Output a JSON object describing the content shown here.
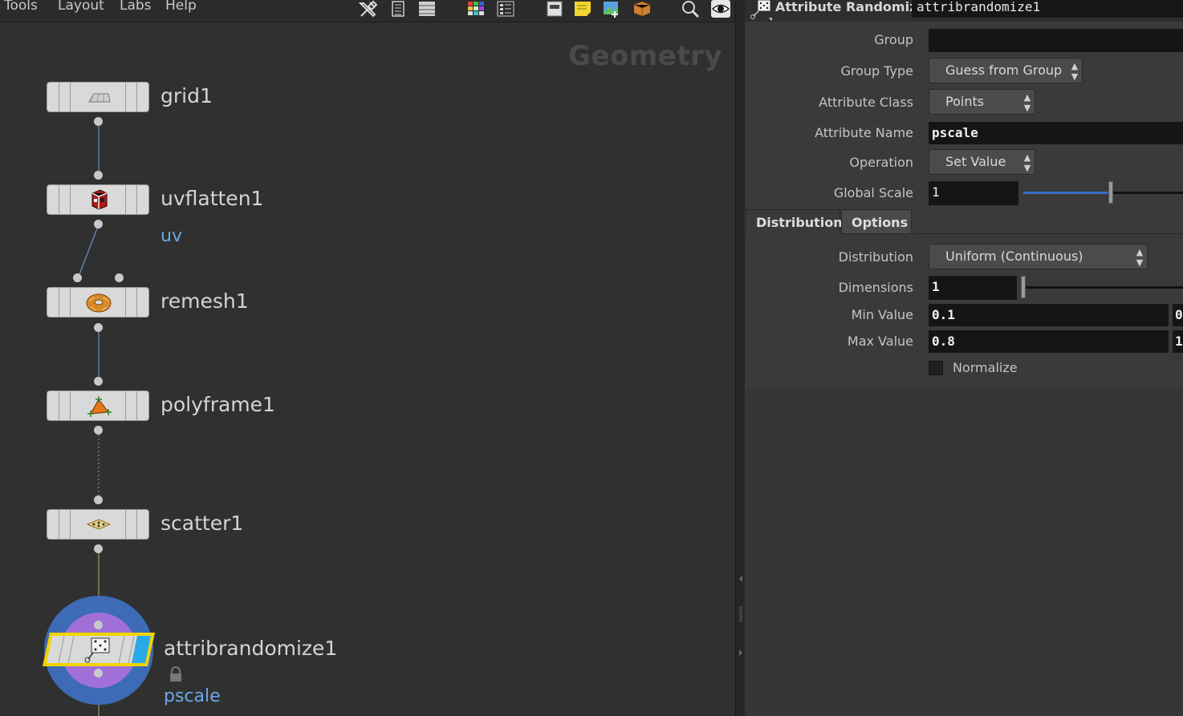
{
  "menubar": {
    "items": [
      "Tools",
      "Layout",
      "Labs",
      "Help"
    ],
    "icons": [
      "wrench-icon",
      "list-icon",
      "table-icon",
      "grid-color-icon",
      "palette-icon",
      "sticky-note-icon",
      "note-icon",
      "image-add-icon",
      "box-icon",
      "search-icon",
      "eye-icon"
    ]
  },
  "network": {
    "context_label": "Geometry",
    "nodes": [
      {
        "name": "grid1",
        "icon": "grid-plane-icon"
      },
      {
        "name": "uvflatten1",
        "icon": "uvflatten-icon",
        "flag": "uv"
      },
      {
        "name": "remesh1",
        "icon": "remesh-donut-icon"
      },
      {
        "name": "polyframe1",
        "icon": "polyframe-icon"
      },
      {
        "name": "scatter1",
        "icon": "scatter-icon"
      },
      {
        "name": "attribrandomize1",
        "icon": "dice-icon",
        "flag": "pscale",
        "selected": true,
        "locked": true
      }
    ]
  },
  "params": {
    "node_type": "Attribute Randomize",
    "node_name": "attribrandomize1",
    "group": {
      "label": "Group",
      "value": ""
    },
    "group_type": {
      "label": "Group Type",
      "value": "Guess from Group"
    },
    "attribute_class": {
      "label": "Attribute Class",
      "value": "Points"
    },
    "attribute_name": {
      "label": "Attribute Name",
      "value": "pscale"
    },
    "operation": {
      "label": "Operation",
      "value": "Set Value"
    },
    "global_scale": {
      "label": "Global Scale",
      "value": "1"
    },
    "tabs": [
      "Distribution",
      "Options"
    ],
    "active_tab": "Distribution",
    "distribution": {
      "label": "Distribution",
      "value": "Uniform (Continuous)"
    },
    "dimensions": {
      "label": "Dimensions",
      "value": "1"
    },
    "min_value": {
      "label": "Min Value",
      "value": "0.1",
      "next": "0"
    },
    "max_value": {
      "label": "Max Value",
      "value": "0.8",
      "next": "1"
    },
    "normalize": {
      "label": "Normalize",
      "checked": false
    }
  },
  "colors": {
    "selected_outline": "#f0d400",
    "selected_accent": "#2aa9e8",
    "flag_blue": "#6ea6e6",
    "ring_outer": "#3d6bb5",
    "ring_inner": "#a070d8"
  }
}
